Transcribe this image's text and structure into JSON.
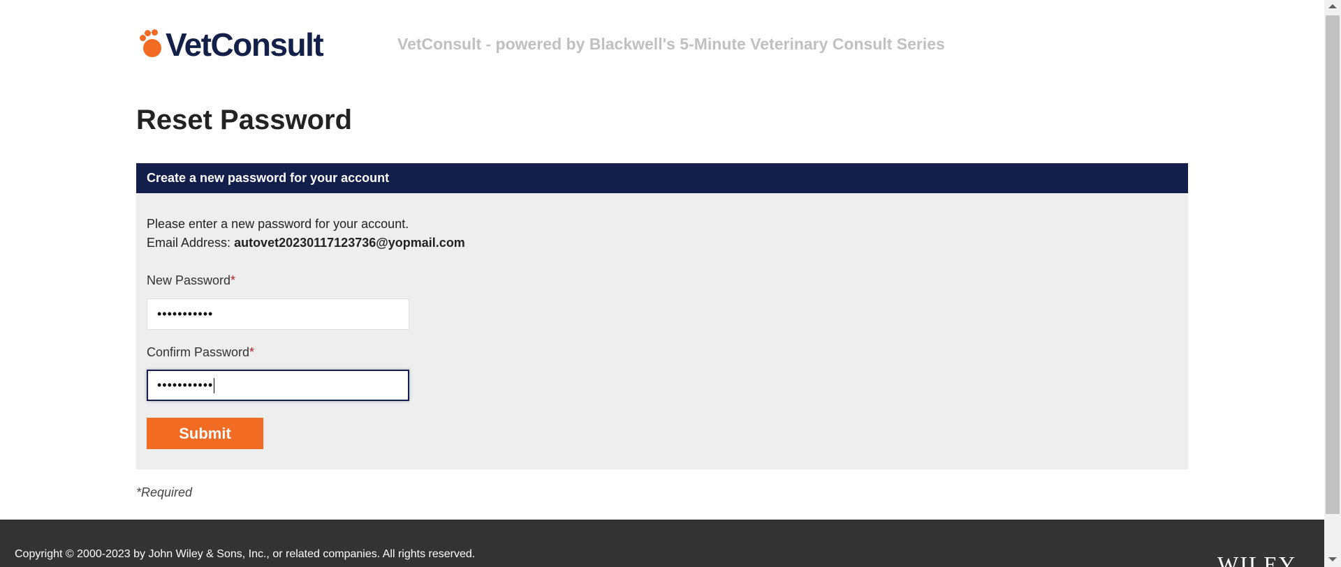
{
  "header": {
    "logo_text": "VetConsult",
    "tagline": "VetConsult - powered by Blackwell's 5-Minute Veterinary Consult Series"
  },
  "page": {
    "title": "Reset Password"
  },
  "panel": {
    "header": "Create a new password for your account",
    "intro": "Please enter a new password for your account.",
    "email_label": "Email Address: ",
    "email_value": "autovet20230117123736@yopmail.com"
  },
  "form": {
    "new_password_label": "New Password",
    "new_password_value": "•••••••••••",
    "confirm_password_label": "Confirm Password",
    "confirm_password_value": "•••••••••••",
    "required_marker": "*",
    "submit_label": "Submit",
    "required_note": "*Required"
  },
  "footer": {
    "copyright": "Copyright © 2000-2023 by John Wiley & Sons, Inc., or related companies. All rights reserved.",
    "brand": "WILEY"
  },
  "colors": {
    "brand_navy": "#121f4b",
    "brand_orange": "#f26b22",
    "panel_bg": "#eeeeee",
    "footer_bg": "#333333"
  },
  "icons": {
    "logo_mark": "paw-icon"
  }
}
